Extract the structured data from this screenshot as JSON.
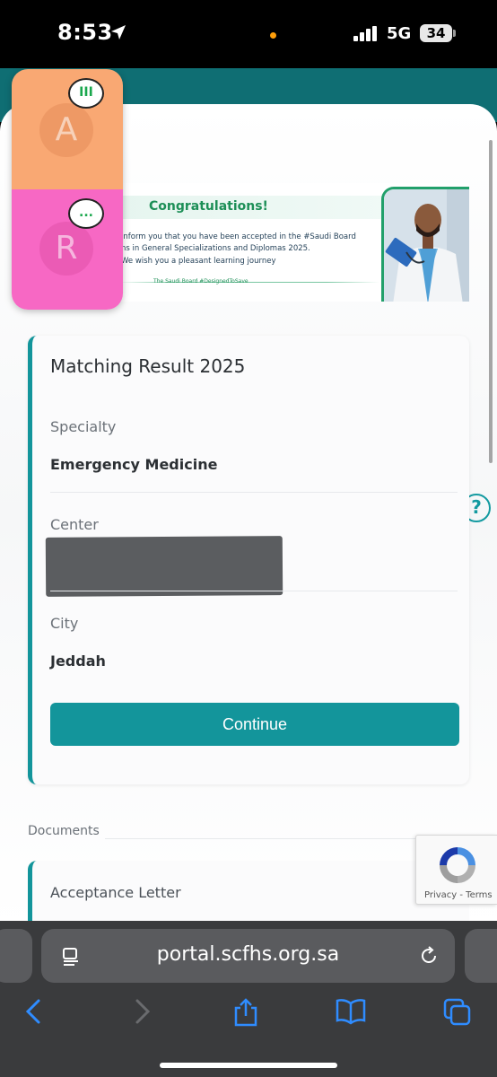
{
  "status_bar": {
    "time": "8:53",
    "network": "5G",
    "battery": "34",
    "indicator_color": "#ff9f0a"
  },
  "banner": {
    "title": "Congratulations!",
    "line1": "inform you that you have been accepted in the #Saudi Board",
    "line2": "ns in General Specializations and Diplomas 2025.",
    "line3": "We wish you a pleasant learning journey",
    "tagline": "The Saudi Board #DesignedToSave"
  },
  "chat_heads": [
    {
      "letter": "A",
      "badge": "III",
      "color": "#f9a873"
    },
    {
      "letter": "R",
      "badge": "...",
      "color": "#f768c4"
    }
  ],
  "result": {
    "title": "Matching Result 2025",
    "specialty_label": "Specialty",
    "specialty_value": "Emergency Medicine",
    "center_label": "Center",
    "city_label": "City",
    "city_value": "Jeddah",
    "continue_label": "Continue"
  },
  "documents": {
    "section_label": "Documents",
    "first_doc": "Acceptance Letter"
  },
  "help": {
    "icon": "question-circle-icon",
    "glyph": "?"
  },
  "recaptcha": {
    "links": "Privacy - Terms"
  },
  "browser": {
    "url": "portal.scfhs.org.sa"
  },
  "colors": {
    "accent": "#13959b",
    "header": "#0f6e73",
    "toolbar_icon": "#2f8cff"
  }
}
